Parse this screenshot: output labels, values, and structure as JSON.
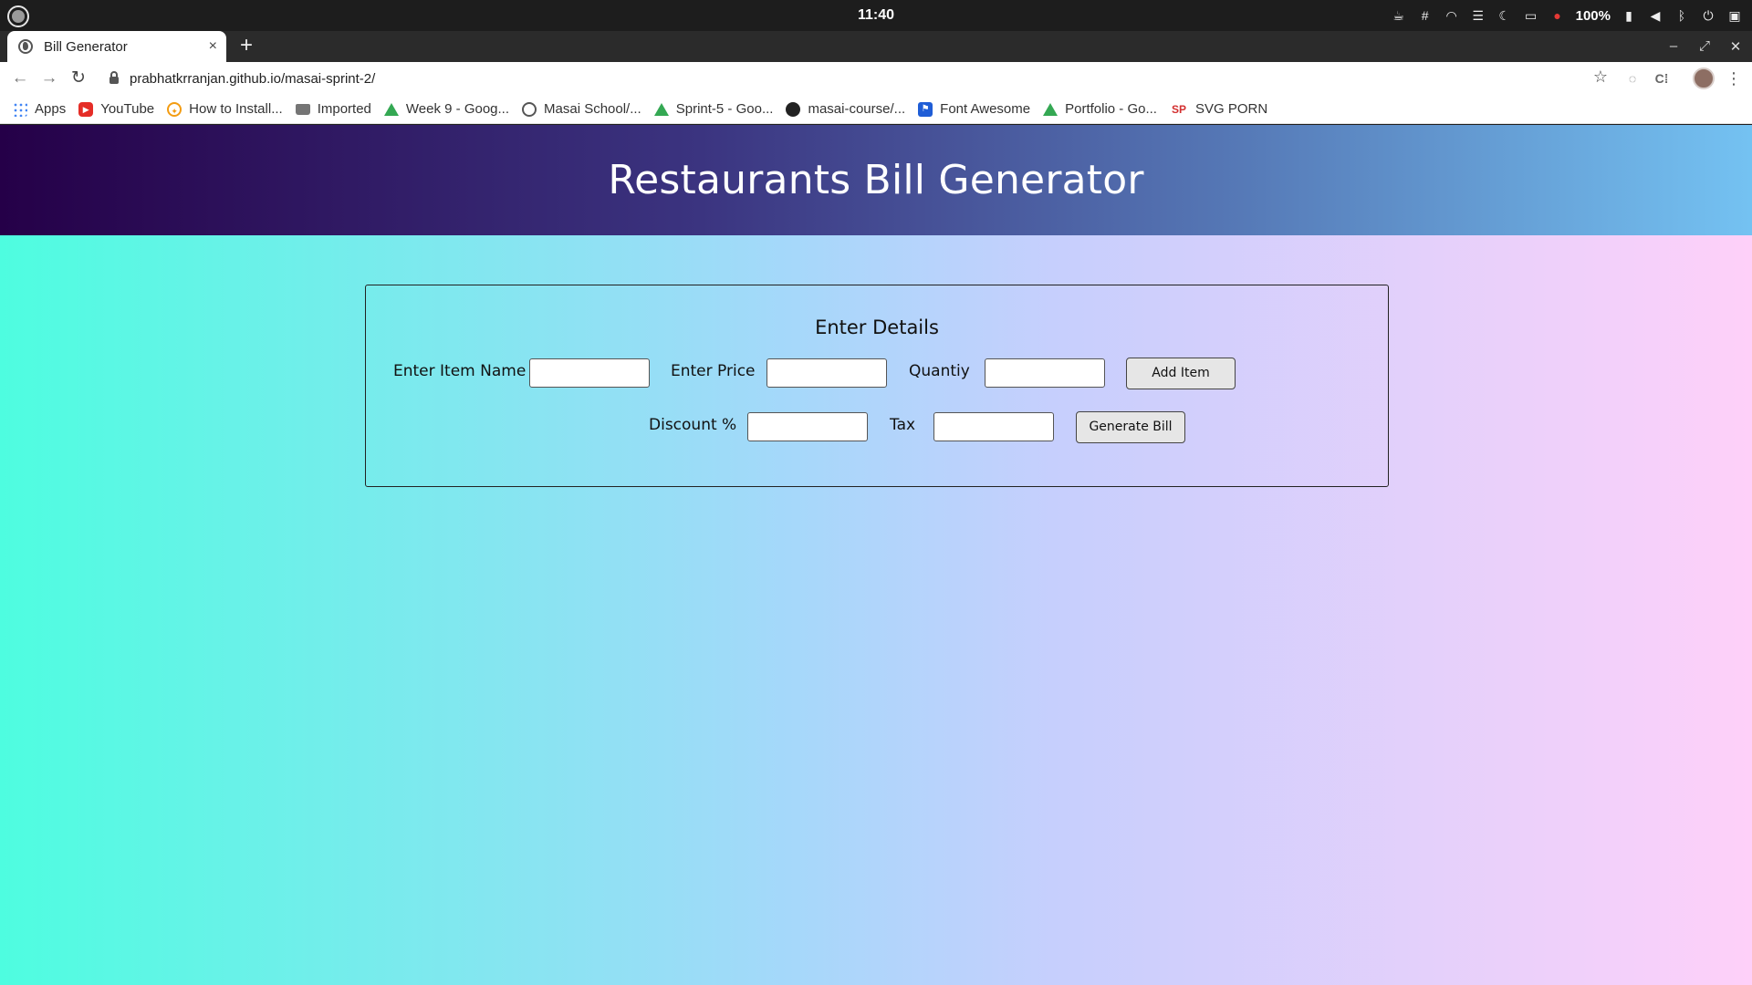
{
  "os": {
    "clock": "11:40",
    "battery": "100%",
    "tray_icons": [
      "coffee-icon",
      "slack-icon",
      "wifi-icon",
      "menu-icon",
      "moon-icon",
      "folder-icon",
      "bell-icon",
      "battery-icon",
      "volume-icon",
      "bluetooth-icon",
      "power-icon",
      "window-icon"
    ]
  },
  "browser": {
    "tab": {
      "title": "Bill Generator",
      "close": "×"
    },
    "new_tab": "+",
    "window_controls": {
      "minimize": "–",
      "maximize": "⤢",
      "close": "✕"
    },
    "url": "prabhatkrranjan.github.io/masai-sprint-2/",
    "bookmarks": [
      {
        "label": "Apps",
        "icon": "apps-icon"
      },
      {
        "label": "YouTube",
        "icon": "youtube-icon"
      },
      {
        "label": "How to Install...",
        "icon": "install-icon"
      },
      {
        "label": "Imported",
        "icon": "folder-icon"
      },
      {
        "label": "Week 9 - Goog...",
        "icon": "drive-icon"
      },
      {
        "label": "Masai School/...",
        "icon": "globe-icon"
      },
      {
        "label": "Sprint-5 - Goo...",
        "icon": "drive-icon"
      },
      {
        "label": "masai-course/...",
        "icon": "github-icon"
      },
      {
        "label": "Font Awesome",
        "icon": "fontawesome-icon"
      },
      {
        "label": "Portfolio - Go...",
        "icon": "drive-icon"
      },
      {
        "label": "SVG PORN",
        "icon": "svgporn-icon"
      }
    ]
  },
  "page": {
    "title": "Restaurants Bill Generator",
    "form": {
      "heading": "Enter Details",
      "item_name_label": "Enter Item Name",
      "item_name_value": "",
      "price_label": "Enter Price",
      "price_value": "",
      "quantity_label": "Quantiy",
      "quantity_value": "",
      "add_item_button": "Add Item",
      "discount_label": "Discount %",
      "discount_value": "",
      "tax_label": "Tax",
      "tax_value": "",
      "generate_bill_button": "Generate Bill"
    },
    "colors": {
      "header_start": "#250048",
      "header_end": "#74c2f2",
      "body_start": "#4efde0",
      "body_end": "#fed0f9"
    }
  }
}
